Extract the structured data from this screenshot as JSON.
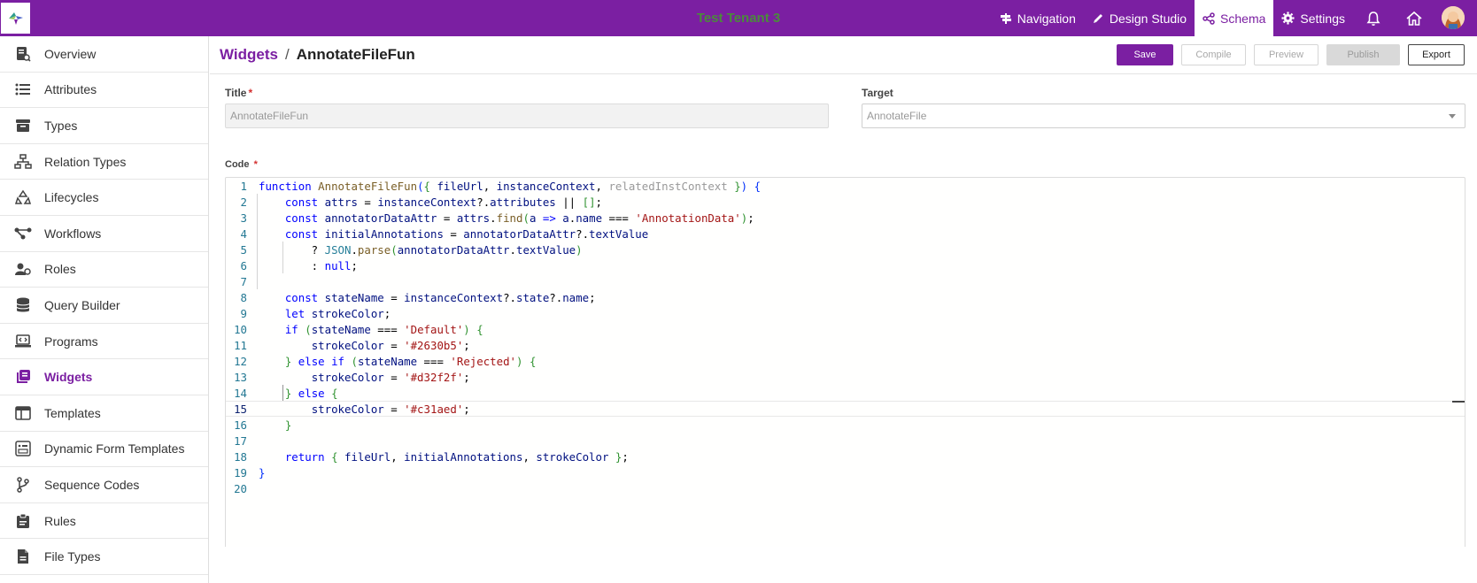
{
  "topbar": {
    "tenant": "Test Tenant 3",
    "nav": [
      {
        "label": "Navigation",
        "icon": "signpost-icon"
      },
      {
        "label": "Design Studio",
        "icon": "pen-icon"
      },
      {
        "label": "Schema",
        "icon": "share-icon",
        "active": true
      },
      {
        "label": "Settings",
        "icon": "gear-icon"
      }
    ],
    "colors": {
      "brand": "#7b1fa2",
      "tenant_text": "#4b8a3c"
    }
  },
  "sidebar": {
    "items": [
      {
        "label": "Overview",
        "icon": "document-search-icon"
      },
      {
        "label": "Attributes",
        "icon": "list-icon"
      },
      {
        "label": "Types",
        "icon": "box-icon"
      },
      {
        "label": "Relation Types",
        "icon": "hierarchy-icon"
      },
      {
        "label": "Lifecycles",
        "icon": "recycle-icon"
      },
      {
        "label": "Workflows",
        "icon": "flow-icon"
      },
      {
        "label": "Roles",
        "icon": "users-icon"
      },
      {
        "label": "Query Builder",
        "icon": "database-icon"
      },
      {
        "label": "Programs",
        "icon": "laptop-code-icon"
      },
      {
        "label": "Widgets",
        "icon": "widgets-icon",
        "active": true
      },
      {
        "label": "Templates",
        "icon": "layout-icon"
      },
      {
        "label": "Dynamic Form Templates",
        "icon": "form-icon"
      },
      {
        "label": "Sequence Codes",
        "icon": "branch-icon"
      },
      {
        "label": "Rules",
        "icon": "clipboard-icon"
      },
      {
        "label": "File Types",
        "icon": "file-icon"
      }
    ]
  },
  "header": {
    "breadcrumb_root": "Widgets",
    "separator": "/",
    "breadcrumb_current": "AnnotateFileFun",
    "buttons": {
      "save": "Save",
      "compile": "Compile",
      "preview": "Preview",
      "publish": "Publish",
      "export": "Export"
    }
  },
  "form": {
    "title_label": "Title",
    "title_value": "AnnotateFileFun",
    "target_label": "Target",
    "target_value": "AnnotateFile",
    "code_label": "Code",
    "required_mark": "*"
  },
  "editor": {
    "current_line": 15,
    "lines": [
      "function AnnotateFileFun({ fileUrl, instanceContext, relatedInstContext }) {",
      "    const attrs = instanceContext?.attributes || [];",
      "    const annotatorDataAttr = attrs.find(a => a.name === 'AnnotationData');",
      "    const initialAnnotations = annotatorDataAttr?.textValue",
      "        ? JSON.parse(annotatorDataAttr.textValue)",
      "        : null;",
      "",
      "    const stateName = instanceContext?.state?.name;",
      "    let strokeColor;",
      "    if (stateName === 'Default') {",
      "        strokeColor = '#2630b5';",
      "    } else if (stateName === 'Rejected') {",
      "        strokeColor = '#d32f2f';",
      "    } else {",
      "        strokeColor = '#c31aed';",
      "    }",
      "",
      "    return { fileUrl, initialAnnotations, strokeColor };",
      "}",
      ""
    ]
  }
}
